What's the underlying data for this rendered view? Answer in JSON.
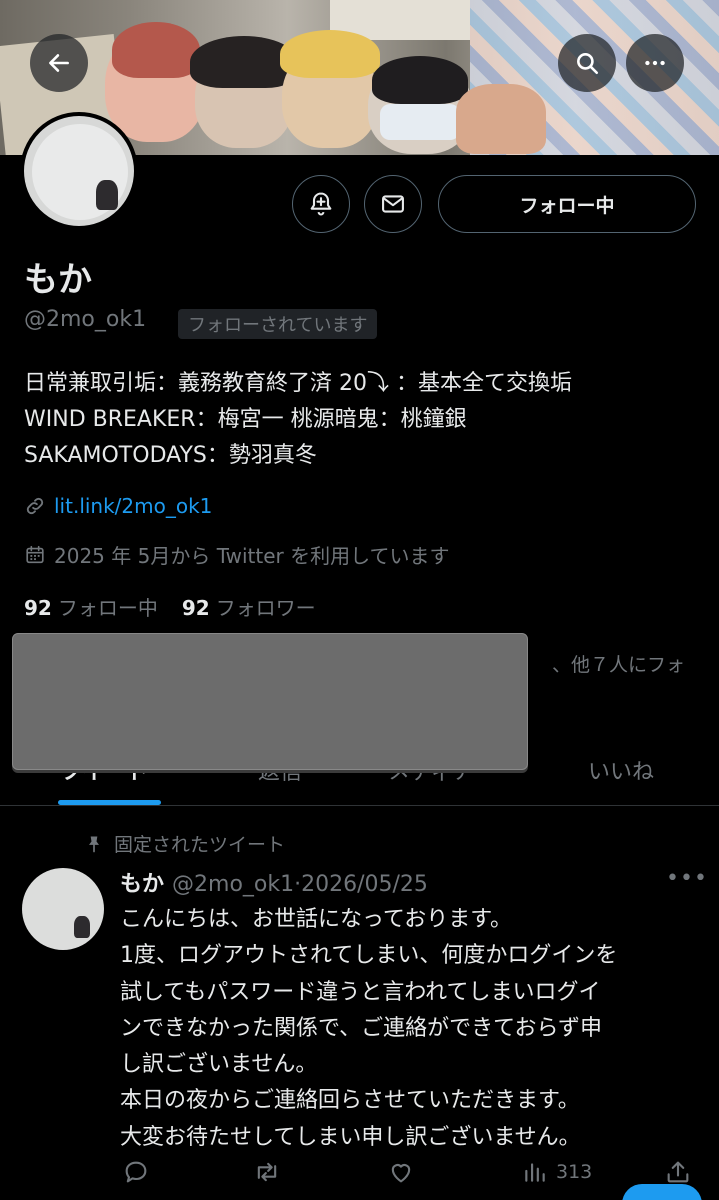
{
  "profile": {
    "display_name": "もか",
    "handle": "@2mo_ok1",
    "follows_you_badge": "フォローされています",
    "follow_button": "フォロー中",
    "bio_lines": [
      "日常兼取引垢：義務教育終了済 20⤵︎ ：基本全て交換垢",
      "WIND BREAKER：梅宮一 桃源暗鬼：桃鐘銀",
      "SAKAMOTODAYS：勢羽真冬"
    ],
    "link": "lit.link/2mo_ok1",
    "joined": "2025 年 5月から Twitter を利用しています",
    "following_count": "92",
    "following_label": "フォロー中",
    "followers_count": "92",
    "followers_label": "フォロワー",
    "followers_known_suffix": "、他７人にフォ"
  },
  "tabs": [
    {
      "label": "ツイート",
      "active": true
    },
    {
      "label": "返信",
      "active": false
    },
    {
      "label": "メディア",
      "active": false
    },
    {
      "label": "いいね",
      "active": false
    }
  ],
  "pinned_tweet": {
    "pinned_label": "固定されたツイート",
    "author_name": "もか",
    "author_handle_date": "@2mo_ok1·2026/05/25",
    "body_lines": [
      "こんにちは、お世話になっております。",
      "1度、ログアウトされてしまい、何度かログインを",
      "試してもパスワード違うと言われてしまいログイ",
      "ンできなかった関係で、ご連絡ができておらず申",
      "し訳ございません。",
      "本日の夜からご連絡回らさせていただきます。",
      "大変お待たせしてしまい申し訳ございません。"
    ],
    "views": "313"
  },
  "colors": {
    "background": "#000000",
    "text_primary": "#e7e9ea",
    "text_secondary": "#71767b",
    "accent": "#1d9bf0",
    "border": "#2f3336"
  },
  "icons": [
    "back-arrow-icon",
    "search-icon",
    "more-icon",
    "notification-bell-plus-icon",
    "mail-icon",
    "link-icon",
    "calendar-icon",
    "pin-icon",
    "reply-icon",
    "retweet-icon",
    "like-icon",
    "views-icon",
    "share-icon"
  ]
}
